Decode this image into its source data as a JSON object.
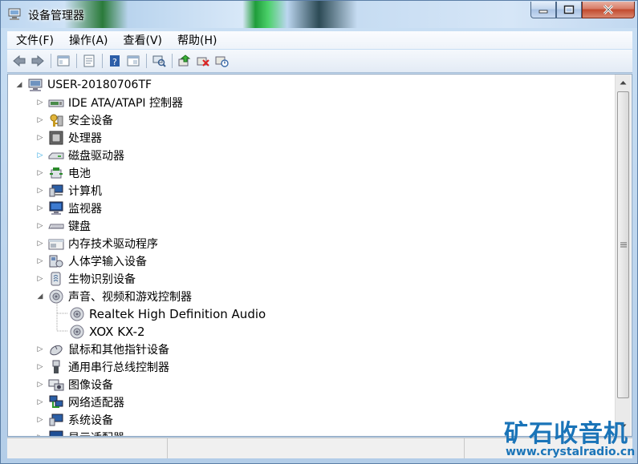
{
  "window": {
    "title": "设备管理器"
  },
  "menu": {
    "items": [
      {
        "label": "文件(F)"
      },
      {
        "label": "操作(A)"
      },
      {
        "label": "查看(V)"
      },
      {
        "label": "帮助(H)"
      }
    ]
  },
  "toolbar": {
    "buttons": [
      "back-icon",
      "forward-icon",
      "console-tree-icon",
      "properties-icon",
      "help-icon",
      "view-icon",
      "scan-hardware-icon",
      "update-driver-icon",
      "uninstall-icon",
      "enable-icon"
    ]
  },
  "tree": {
    "root": "USER-20180706TF",
    "categories": [
      {
        "label": "IDE ATA/ATAPI 控制器",
        "icon": "ide-controller-icon"
      },
      {
        "label": "安全设备",
        "icon": "security-key-icon"
      },
      {
        "label": "处理器",
        "icon": "processor-icon"
      },
      {
        "label": "磁盘驱动器",
        "icon": "disk-drive-icon"
      },
      {
        "label": "电池",
        "icon": "battery-icon"
      },
      {
        "label": "计算机",
        "icon": "computer-icon"
      },
      {
        "label": "监视器",
        "icon": "monitor-icon"
      },
      {
        "label": "键盘",
        "icon": "keyboard-icon"
      },
      {
        "label": "内存技术驱动程序",
        "icon": "memory-icon"
      },
      {
        "label": "人体学输入设备",
        "icon": "hid-icon"
      },
      {
        "label": "生物识别设备",
        "icon": "biometric-icon"
      },
      {
        "label": "声音、视频和游戏控制器",
        "icon": "speaker-icon"
      },
      {
        "label": "鼠标和其他指针设备",
        "icon": "mouse-icon"
      },
      {
        "label": "通用串行总线控制器",
        "icon": "usb-icon"
      },
      {
        "label": "图像设备",
        "icon": "camera-icon"
      },
      {
        "label": "网络适配器",
        "icon": "network-icon"
      },
      {
        "label": "系统设备",
        "icon": "system-device-icon"
      },
      {
        "label": "显示适配器",
        "icon": "display-adapter-icon"
      }
    ],
    "audio_children": [
      {
        "label": "Realtek High Definition Audio"
      },
      {
        "label": "XOX KX-2"
      }
    ]
  },
  "watermark": {
    "title": "矿石收音机",
    "url": "www.crystalradio.cn"
  },
  "colors": {
    "accent": "#1a74b8",
    "close": "#c24a2e"
  }
}
